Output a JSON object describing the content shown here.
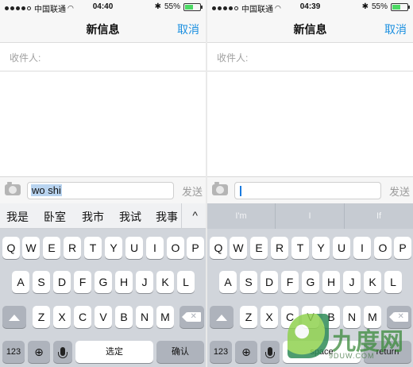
{
  "left": {
    "status": {
      "carrier": "中国联通",
      "time": "04:40",
      "battery": "55%"
    },
    "nav": {
      "title": "新信息",
      "cancel": "取消"
    },
    "recipient_label": "收件人:",
    "input_value": "wo shi",
    "send_label": "发送",
    "candidates": [
      "我是",
      "卧室",
      "我市",
      "我试",
      "我事"
    ],
    "collapse_glyph": "^",
    "keyboard": {
      "row1": [
        "Q",
        "W",
        "E",
        "R",
        "T",
        "Y",
        "U",
        "I",
        "O",
        "P"
      ],
      "row2": [
        "A",
        "S",
        "D",
        "F",
        "G",
        "H",
        "J",
        "K",
        "L"
      ],
      "row3": [
        "Z",
        "X",
        "C",
        "V",
        "B",
        "N",
        "M"
      ],
      "numbers": "123",
      "space": "选定",
      "return": "确认"
    }
  },
  "right": {
    "status": {
      "carrier": "中国联通",
      "time": "04:39",
      "battery": "55%"
    },
    "nav": {
      "title": "新信息",
      "cancel": "取消"
    },
    "recipient_label": "收件人:",
    "input_value": "",
    "send_label": "发送",
    "predictions": [
      "I'm",
      "I",
      "If"
    ],
    "keyboard": {
      "row1": [
        "Q",
        "W",
        "E",
        "R",
        "T",
        "Y",
        "U",
        "I",
        "O",
        "P"
      ],
      "row2": [
        "A",
        "S",
        "D",
        "F",
        "G",
        "H",
        "J",
        "K",
        "L"
      ],
      "row3": [
        "Z",
        "X",
        "C",
        "V",
        "B",
        "N",
        "M"
      ],
      "numbers": "123",
      "space": "space",
      "return": "return"
    }
  },
  "watermark": {
    "text": "九度网",
    "sub": "9DUW.COM"
  },
  "colors": {
    "accent": "#1a8fe0",
    "battery": "#4cd964",
    "keyboard_bg": "#d1d5db"
  },
  "icons": [
    "signal-dots-icon",
    "wifi-icon",
    "bluetooth-icon",
    "battery-icon",
    "camera-icon",
    "shift-icon",
    "delete-icon",
    "globe-icon",
    "microphone-icon",
    "chevron-up-icon"
  ]
}
